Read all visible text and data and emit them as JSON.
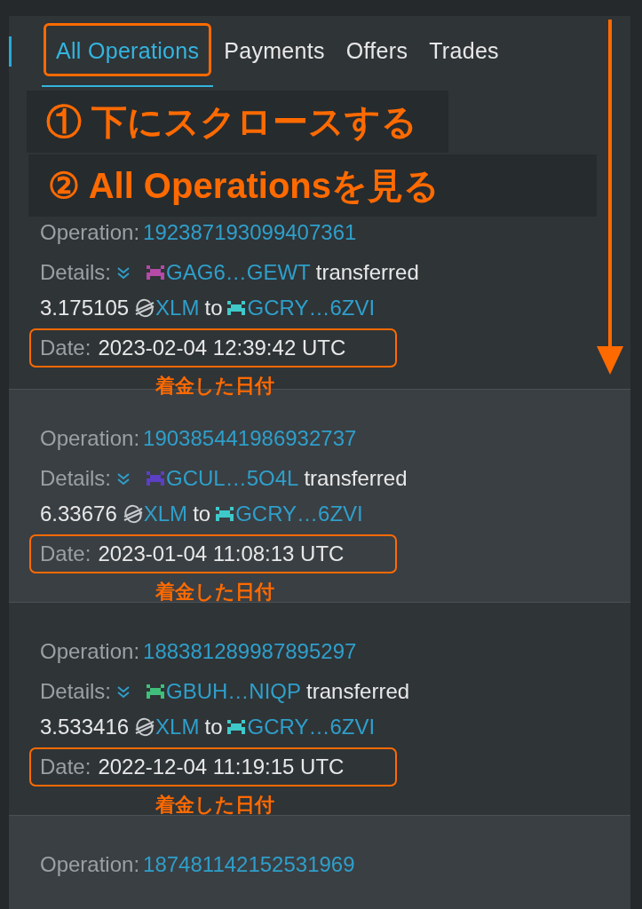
{
  "tabs": [
    {
      "label": "All Operations",
      "selected": true,
      "highlighted": true
    },
    {
      "label": "Payments",
      "selected": false,
      "highlighted": false
    },
    {
      "label": "Offers",
      "selected": false,
      "highlighted": false
    },
    {
      "label": "Trades",
      "selected": false,
      "highlighted": false
    }
  ],
  "steps": [
    {
      "number": "①",
      "text": "下にスクロースする"
    },
    {
      "number": "②",
      "text": "All Operationsを見る"
    }
  ],
  "operations": [
    {
      "operation_label": "Operation:",
      "id": "192387193099407361",
      "details_label": "Details:",
      "from": {
        "account": "GAG6…GEWT",
        "color": "#b54aa8"
      },
      "verb": "transferred",
      "amount": "3.175105",
      "asset": "XLM",
      "to_word": "to",
      "to": {
        "account": "GCRY…6ZVI",
        "color": "#3fc9c9"
      },
      "date_label": "Date:",
      "date": "2023-02-04 12:39:42 UTC",
      "note": "着金した日付"
    },
    {
      "operation_label": "Operation:",
      "id": "190385441986932737",
      "details_label": "Details:",
      "from": {
        "account": "GCUL…5O4L",
        "color": "#5b3fc4"
      },
      "verb": "transferred",
      "amount": "6.33676",
      "asset": "XLM",
      "to_word": "to",
      "to": {
        "account": "GCRY…6ZVI",
        "color": "#3fc9c9"
      },
      "date_label": "Date:",
      "date": "2023-01-04 11:08:13 UTC",
      "note": "着金した日付"
    },
    {
      "operation_label": "Operation:",
      "id": "188381289987895297",
      "details_label": "Details:",
      "from": {
        "account": "GBUH…NIQP",
        "color": "#3fbf7a"
      },
      "verb": "transferred",
      "amount": "3.533416",
      "asset": "XLM",
      "to_word": "to",
      "to": {
        "account": "GCRY…6ZVI",
        "color": "#3fc9c9"
      },
      "date_label": "Date:",
      "date": "2022-12-04 11:19:15 UTC",
      "note": "着金した日付"
    },
    {
      "operation_label": "Operation:",
      "id": "187481142152531969"
    }
  ]
}
